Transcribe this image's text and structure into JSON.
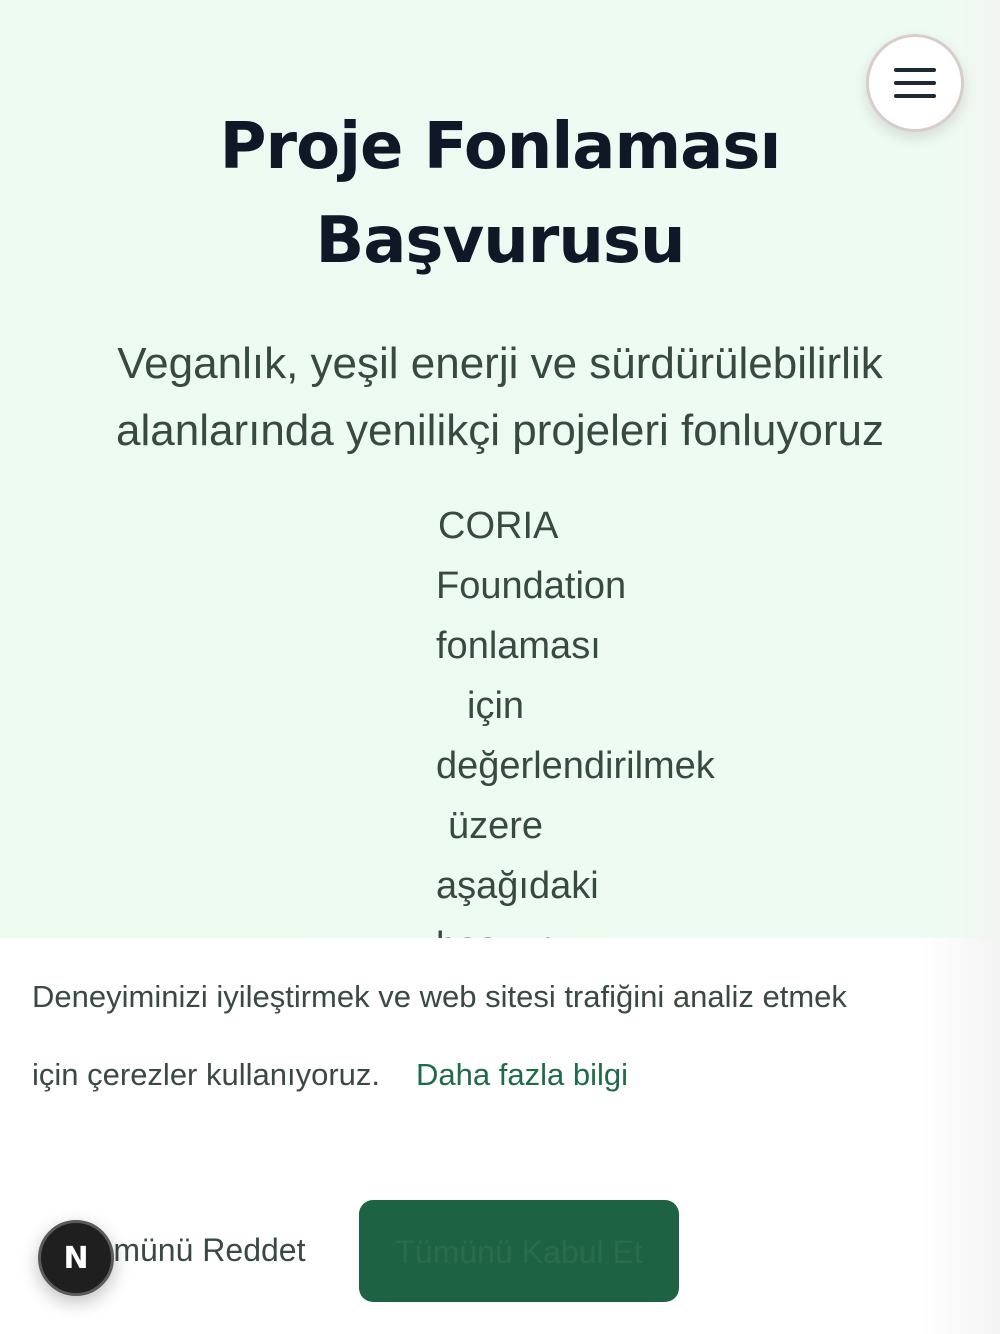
{
  "header": {
    "menu_icon": "hamburger-menu-icon"
  },
  "hero": {
    "title_line1": "Proje Fonlaması",
    "title_line2": "Başvurusu",
    "subtitle_line1": "Veganlık, yeşil enerji ve sürdürülebilirlik",
    "subtitle_line2": "alanlarında yenilikçi projeleri fonluyoruz",
    "intro_words": [
      "CORIA",
      "Foundation",
      "fonlaması",
      "için",
      "değerlendirilmek",
      "üzere",
      "aşağıdaki",
      "başvuru"
    ]
  },
  "cookie_banner": {
    "message_line1": "Deneyiminizi iyileştirmek ve web sitesi trafiğini analiz etmek",
    "message_line2": "için çerezler kullanıyoruz.",
    "learn_more_link": "Daha fazla bilgi",
    "reject_label": "Tümünü Reddet",
    "accept_label": "Tümünü Kabul Et"
  },
  "dev_badge": {
    "letter": "N",
    "icon": "nextjs-logo-icon"
  },
  "colors": {
    "background": "#ecfaf0",
    "title": "#101828",
    "body_text": "#374a3f",
    "accent": "#1d6343",
    "link": "#1d6b48"
  }
}
